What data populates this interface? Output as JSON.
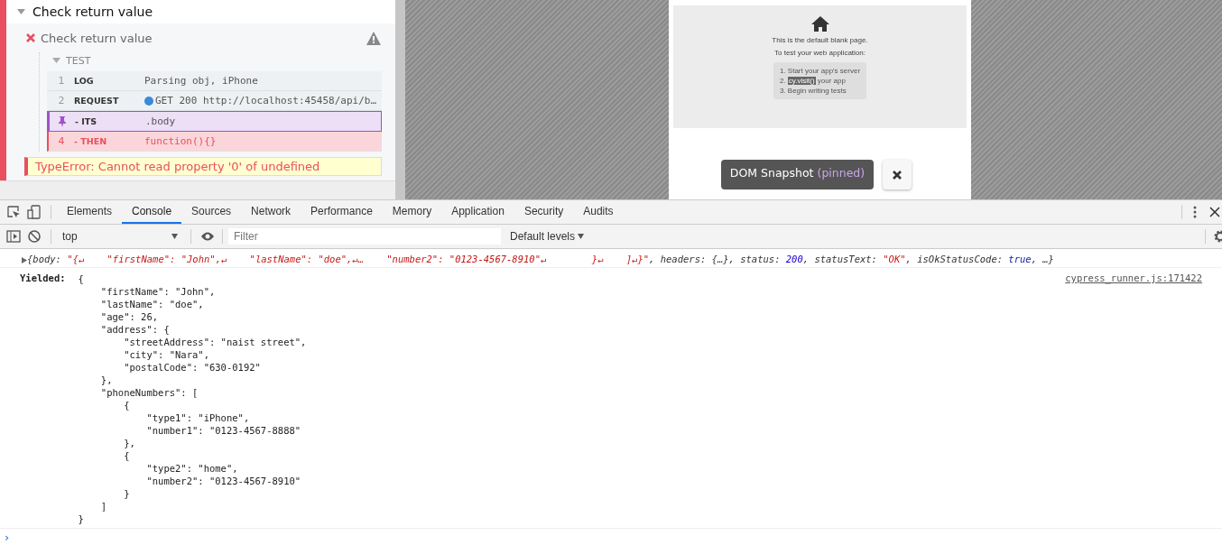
{
  "reporter": {
    "suite": {
      "title": "Check return value",
      "expanded": true
    },
    "test": {
      "title": "Check return value",
      "failed": true,
      "hook": "TEST",
      "commands": [
        {
          "kind": "numbered",
          "number": "1",
          "name": "LOG",
          "message": "Parsing obj, iPhone",
          "pinned": false,
          "failed": false,
          "request_dot": false
        },
        {
          "kind": "numbered",
          "number": "2",
          "name": "REQUEST",
          "message": "GET 200 http://localhost:45458/api/b…",
          "pinned": false,
          "failed": false,
          "request_dot": true
        },
        {
          "kind": "pinned",
          "name": "- ITS",
          "message": ".body",
          "pinned": true,
          "failed": false,
          "request_dot": false
        },
        {
          "kind": "numbered",
          "number": "4",
          "name": "- THEN",
          "message": "function(){}",
          "pinned": false,
          "failed": true,
          "request_dot": false
        }
      ],
      "error": "TypeError: Cannot read property '0' of undefined"
    }
  },
  "aut": {
    "heading": "This is the default blank page.",
    "subheading": "To test your web application:",
    "steps": [
      {
        "number": "1.",
        "text": "Start your app's server"
      },
      {
        "number": "2.",
        "code": "cy.visit()",
        "text": "your app"
      },
      {
        "number": "3.",
        "text": "Begin writing tests"
      }
    ],
    "snapshot": {
      "label": "DOM Snapshot",
      "state": "(pinned)"
    }
  },
  "devtools": {
    "tabs": [
      {
        "label": "Elements",
        "selected": false
      },
      {
        "label": "Console",
        "selected": true
      },
      {
        "label": "Sources",
        "selected": false
      },
      {
        "label": "Network",
        "selected": false
      },
      {
        "label": "Performance",
        "selected": false
      },
      {
        "label": "Memory",
        "selected": false
      },
      {
        "label": "Application",
        "selected": false
      },
      {
        "label": "Security",
        "selected": false
      },
      {
        "label": "Audits",
        "selected": false
      }
    ],
    "context": "top",
    "filter": {
      "placeholder": "Filter"
    },
    "levels": "Default levels",
    "messages": [
      {
        "kind": "object",
        "expanded": false,
        "segments": [
          {
            "kind": "key",
            "text": "{body: "
          },
          {
            "kind": "string",
            "text": "\"{↵    \"firstName\": \"John\",↵    \"lastName\": \"doe\",↵…    \"number2\": \"0123-4567-8910\"↵        }↵    ]↵}\""
          },
          {
            "kind": "key",
            "text": ", headers: {…}, status: "
          },
          {
            "kind": "number",
            "text": "200"
          },
          {
            "kind": "key",
            "text": ", statusText: "
          },
          {
            "kind": "string",
            "text": "\"OK\""
          },
          {
            "kind": "key",
            "text": ", isOkStatusCode: "
          },
          {
            "kind": "bool",
            "text": "true"
          },
          {
            "kind": "key",
            "text": ", …}"
          }
        ]
      },
      {
        "kind": "yielded",
        "label": "Yielded:",
        "source": "cypress_runner.js:171422",
        "value": "{\n    \"firstName\": \"John\",\n    \"lastName\": \"doe\",\n    \"age\": 26,\n    \"address\": {\n        \"streetAddress\": \"naist street\",\n        \"city\": \"Nara\",\n        \"postalCode\": \"630-0192\"\n    },\n    \"phoneNumbers\": [\n        {\n            \"type1\": \"iPhone\",\n            \"number1\": \"0123-4567-8888\"\n        },\n        {\n            \"type2\": \"home\",\n            \"number2\": \"0123-4567-8910\"\n        }\n    ]\n}"
      }
    ],
    "prompt": "›"
  }
}
